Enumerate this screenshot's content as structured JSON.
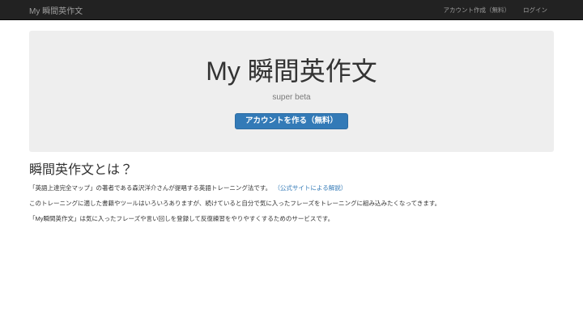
{
  "navbar": {
    "brand": "My 瞬間英作文",
    "links": [
      {
        "label": "アカウント作成（無料）"
      },
      {
        "label": "ログイン"
      }
    ]
  },
  "hero": {
    "title": "My 瞬間英作文",
    "subtitle": "super beta",
    "cta_label": "アカウントを作る（無料）"
  },
  "about": {
    "heading": "瞬間英作文とは？",
    "paragraph1": "「英語上達完全マップ」の著者である森沢洋介さんが提唱する英語トレーニング法です。",
    "paragraph1_link": "（公式サイトによる解説）",
    "paragraph2": "このトレーニングに適した書籍やツールはいろいろありますが、続けていると自分で気に入ったフレーズをトレーニングに組み込みたくなってきます。",
    "paragraph3": "「My瞬間英作文」は気に入ったフレーズや言い回しを登録して反復練習をやりやすくするためのサービスです。"
  },
  "colors": {
    "navbar_bg": "#222222",
    "navbar_text": "#9d9d9d",
    "jumbotron_bg": "#eeeeee",
    "primary": "#337ab7",
    "primary_border": "#2e6da4",
    "link": "#337ab7",
    "text": "#333333",
    "muted": "#7a7a7a"
  }
}
